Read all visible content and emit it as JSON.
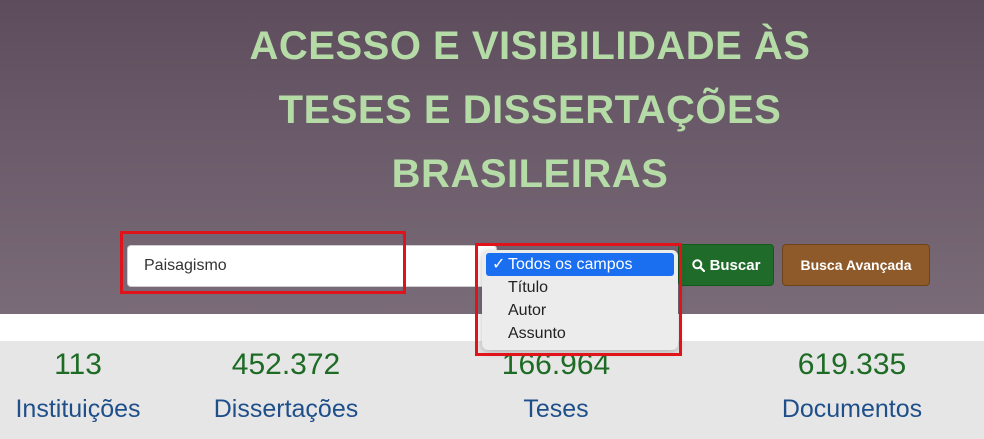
{
  "hero": {
    "title_lines": [
      "ACESSO E VISIBILIDADE ÀS",
      "TESES E DISSERTAÇÕES",
      "BRASILEIRAS"
    ],
    "title_color": "#b5dba7"
  },
  "search": {
    "value": "Paisagismo",
    "field_select": {
      "options": [
        "Todos os campos",
        "Título",
        "Autor",
        "Assunto"
      ],
      "selected": "Todos os campos",
      "check_mark": "✓"
    },
    "buscar_label": "Buscar",
    "avancada_label": "Busca Avançada"
  },
  "stats": [
    {
      "value": "113",
      "label": "Instituições"
    },
    {
      "value": "452.372",
      "label": "Dissertações"
    },
    {
      "value": "166.964",
      "label": "Teses"
    },
    {
      "value": "619.335",
      "label": "Documentos"
    }
  ],
  "colors": {
    "buscar": "#1f6b2a",
    "avancada": "#8e5a2a",
    "highlight": "#e0121a",
    "selected_option": "#1a6ff0",
    "stat_number": "#1d6b25",
    "stat_label": "#1f4f8a"
  },
  "icons": {
    "buscar": "search-icon"
  }
}
